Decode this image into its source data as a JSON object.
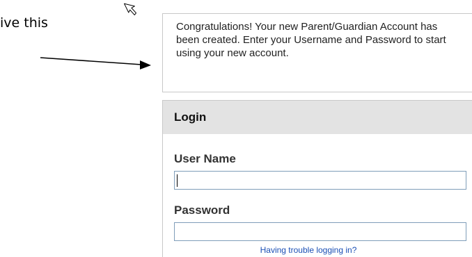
{
  "annotation": {
    "text": "ive this"
  },
  "message": {
    "text": "Congratulations! Your new Parent/Guardian Account has been created. Enter your Username and Password to start using your new account."
  },
  "login": {
    "header": "Login",
    "username_label": "User Name",
    "username_value": "",
    "password_label": "Password",
    "password_value": "",
    "trouble_link": "Having trouble logging in?"
  },
  "icons": {
    "cursor": "mouse-pointer-icon",
    "arrow": "annotation-arrow-icon"
  }
}
